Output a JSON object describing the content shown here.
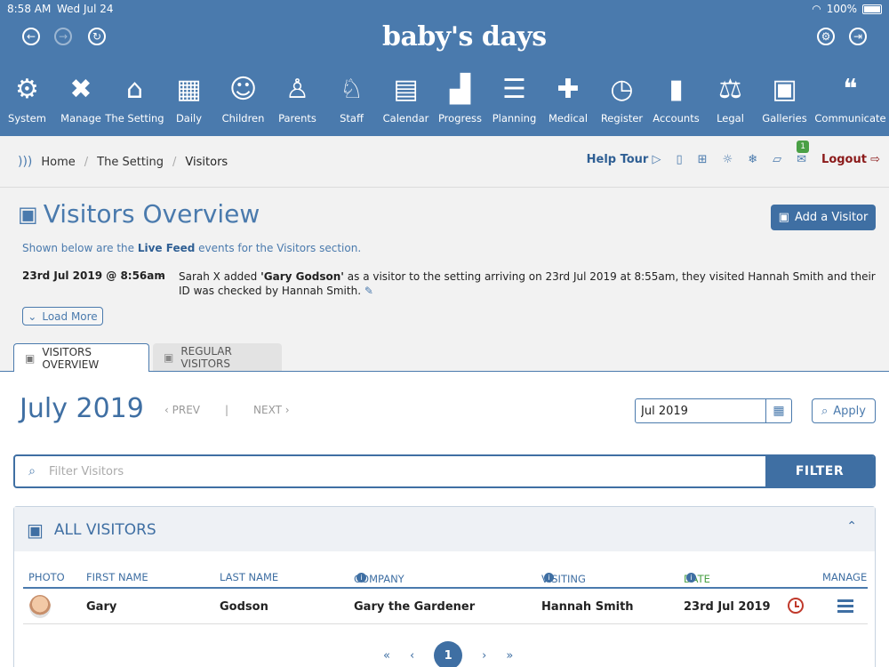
{
  "status": {
    "time": "8:58 AM",
    "date": "Wed Jul 24",
    "battery": "100%"
  },
  "app": {
    "logo": "baby's days"
  },
  "nav": [
    {
      "label": "System",
      "icon": "⚙",
      "name": "gear-icon"
    },
    {
      "label": "Manage",
      "icon": "✖",
      "name": "tools-icon"
    },
    {
      "label": "The Setting",
      "icon": "⌂",
      "name": "house-icon"
    },
    {
      "label": "Daily",
      "icon": "▦",
      "name": "calendar-24-icon"
    },
    {
      "label": "Children",
      "icon": "☺",
      "name": "baby-face-icon"
    },
    {
      "label": "Parents",
      "icon": "♙",
      "name": "parents-icon"
    },
    {
      "label": "Staff",
      "icon": "♘",
      "name": "staff-icon"
    },
    {
      "label": "Calendar",
      "icon": "▤",
      "name": "calendar-icon"
    },
    {
      "label": "Progress",
      "icon": "▟",
      "name": "progress-chart-icon"
    },
    {
      "label": "Planning",
      "icon": "☰",
      "name": "checklist-icon"
    },
    {
      "label": "Medical",
      "icon": "✚",
      "name": "medical-cross-icon"
    },
    {
      "label": "Register",
      "icon": "◷",
      "name": "clock-icon"
    },
    {
      "label": "Accounts",
      "icon": "▮",
      "name": "binders-icon"
    },
    {
      "label": "Legal",
      "icon": "⚖",
      "name": "scales-icon"
    },
    {
      "label": "Galleries",
      "icon": "▣",
      "name": "gallery-icon"
    },
    {
      "label": "Communicate",
      "icon": "❝",
      "name": "chat-bubbles-icon"
    }
  ],
  "breadcrumb": {
    "home": "Home",
    "setting": "The Setting",
    "current": "Visitors"
  },
  "toolbar": {
    "help": "Help Tour",
    "badge": "1",
    "logout": "Logout"
  },
  "overview": {
    "title": "Visitors Overview",
    "add_button": "Add a Visitor",
    "intro_pre": "Shown below are the ",
    "intro_bold": "Live Feed",
    "intro_post": " events for the Visitors section.",
    "feed": {
      "when": "23rd Jul 2019 @ 8:56am",
      "dash": "-",
      "text_pre": "Sarah X added ",
      "text_bold": "'Gary Godson'",
      "text_post": " as a visitor to the setting arriving on 23rd Jul 2019 at 8:55am, they visited Hannah Smith and their ID was checked by Hannah Smith."
    },
    "load_more": "Load More"
  },
  "tabs": {
    "overview": "VISITORS OVERVIEW",
    "regular": "REGULAR VISITORS"
  },
  "month": {
    "title": "July 2019",
    "prev": "PREV",
    "sep": "|",
    "next": "NEXT",
    "input_value": "Jul 2019",
    "apply": "Apply"
  },
  "filter": {
    "placeholder": "Filter Visitors",
    "button": "FILTER"
  },
  "panel": {
    "title": "ALL VISITORS",
    "columns": {
      "photo": "PHOTO",
      "first": "FIRST NAME",
      "last": "LAST NAME",
      "company": "COMPANY",
      "visiting": "VISITING",
      "date": "DATE",
      "manage": "MANAGE"
    },
    "rows": [
      {
        "first": "Gary",
        "last": "Godson",
        "company": "Gary the Gardener",
        "visiting": "Hannah Smith",
        "date": "23rd Jul 2019"
      }
    ]
  },
  "pager": {
    "first": "«",
    "prev": "‹",
    "page": "1",
    "next": "›",
    "last": "»"
  }
}
